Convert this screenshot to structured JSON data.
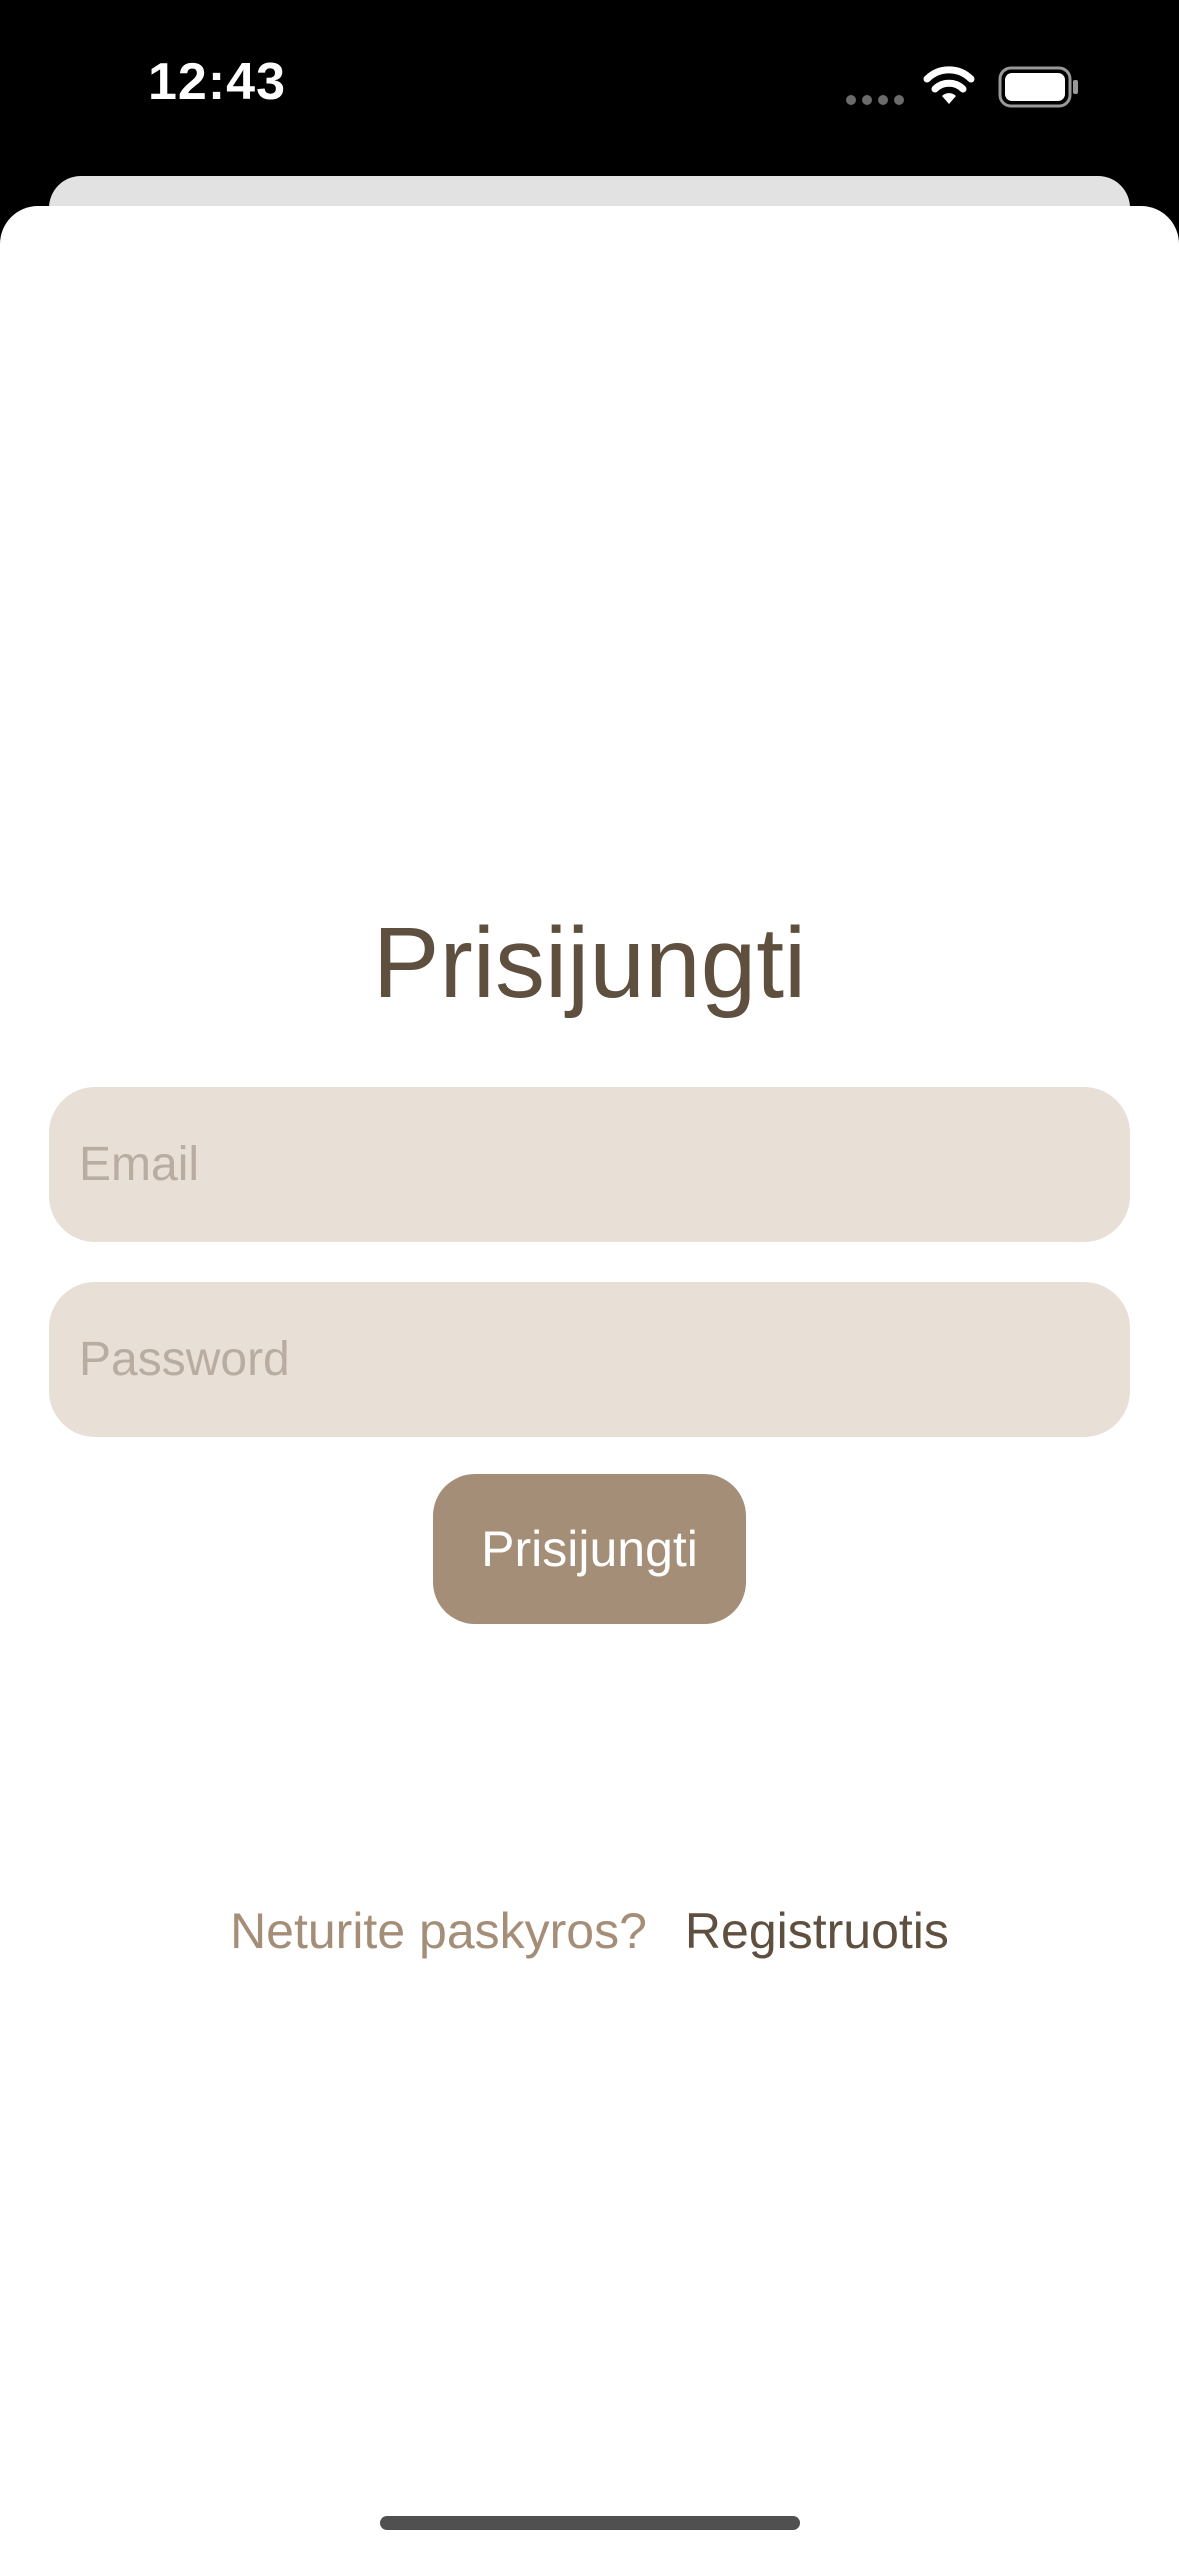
{
  "status_bar": {
    "time": "12:43",
    "icons": [
      "signal-dots-icon",
      "wifi-icon",
      "battery-icon"
    ]
  },
  "login": {
    "title": "Prisijungti",
    "email_placeholder": "Email",
    "email_value": "",
    "password_placeholder": "Password",
    "password_value": "",
    "submit_label": "Prisijungti",
    "register_prompt": "Neturite paskyros?",
    "register_link": "Registruotis"
  },
  "colors": {
    "background": "#ffffff",
    "status_bar": "#000000",
    "title_text": "#5f4f3e",
    "field_fill": "#e8dfd6",
    "placeholder_text": "#b9ada2",
    "button_fill": "#a48e78",
    "button_text": "#ffffff",
    "prompt_text": "#a48e78",
    "link_text": "#5f4f3e"
  }
}
